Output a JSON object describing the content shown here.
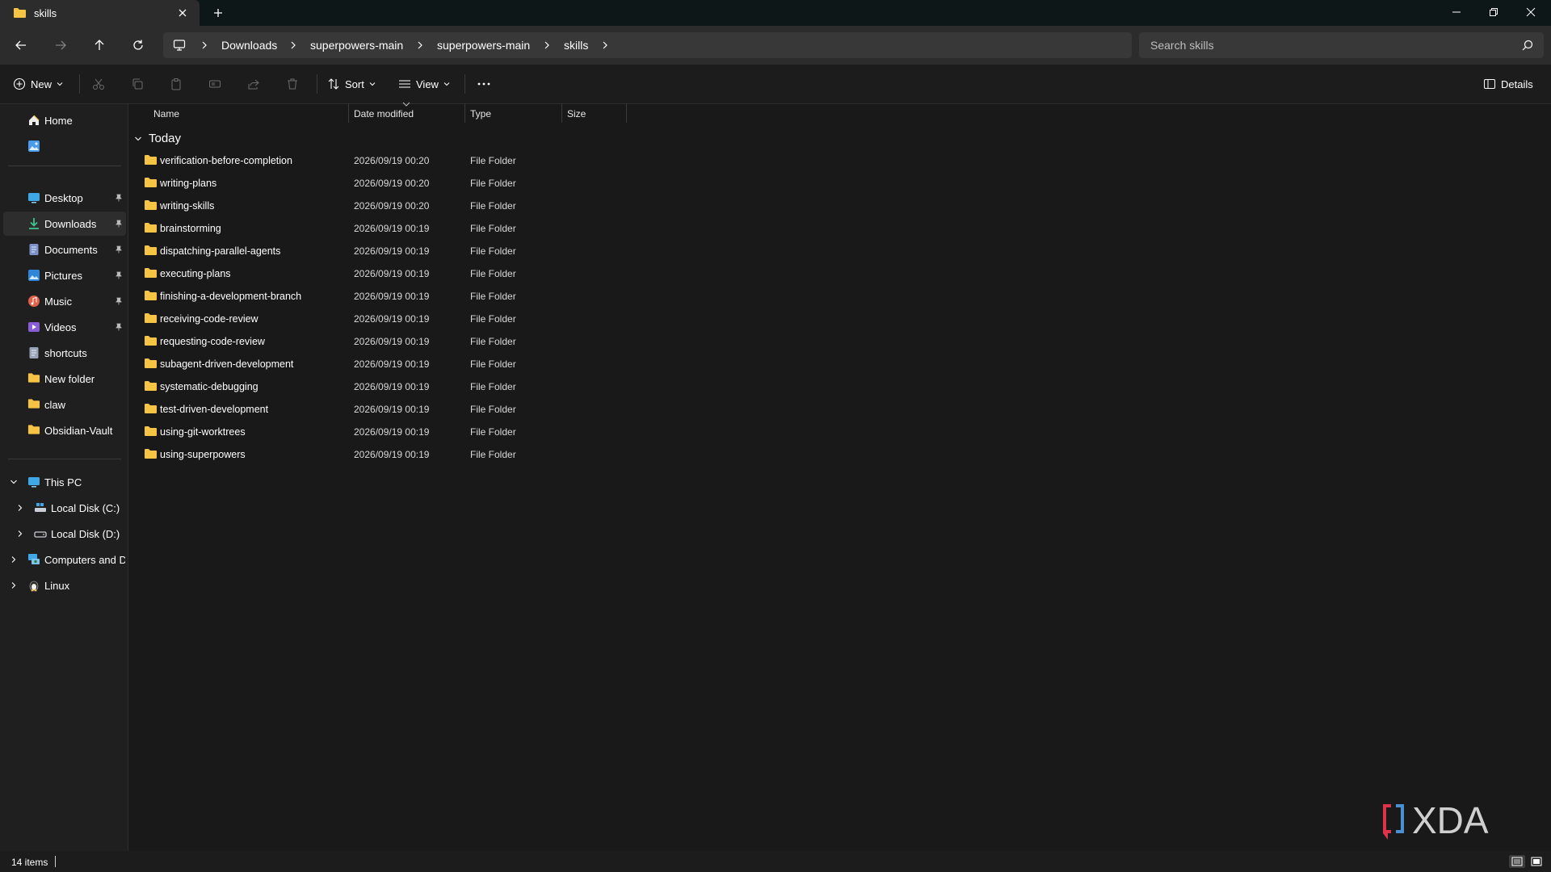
{
  "window": {
    "tab_title": "skills"
  },
  "breadcrumb": [
    "Downloads",
    "superpowers-main",
    "superpowers-main",
    "skills"
  ],
  "search": {
    "placeholder": "Search skills"
  },
  "toolbar": {
    "new_label": "New",
    "sort_label": "Sort",
    "view_label": "View",
    "details_label": "Details"
  },
  "sidebar": {
    "home": "Home",
    "quick_access": [
      "Desktop",
      "Downloads",
      "Documents",
      "Pictures",
      "Music",
      "Videos",
      "shortcuts",
      "New folder",
      "claw",
      "Obsidian-Vault"
    ],
    "this_pc": "This PC",
    "drives": [
      "Local Disk (C:)",
      "Local Disk (D:)"
    ],
    "network": "Computers and De",
    "linux": "Linux",
    "selected": "Downloads"
  },
  "columns": {
    "name": "Name",
    "date": "Date modified",
    "type": "Type",
    "size": "Size"
  },
  "group": {
    "label": "Today"
  },
  "files": [
    {
      "name": "verification-before-completion",
      "date": "2026/09/19 00:20",
      "type": "File Folder"
    },
    {
      "name": "writing-plans",
      "date": "2026/09/19 00:20",
      "type": "File Folder"
    },
    {
      "name": "writing-skills",
      "date": "2026/09/19 00:20",
      "type": "File Folder"
    },
    {
      "name": "brainstorming",
      "date": "2026/09/19 00:19",
      "type": "File Folder"
    },
    {
      "name": "dispatching-parallel-agents",
      "date": "2026/09/19 00:19",
      "type": "File Folder"
    },
    {
      "name": "executing-plans",
      "date": "2026/09/19 00:19",
      "type": "File Folder"
    },
    {
      "name": "finishing-a-development-branch",
      "date": "2026/09/19 00:19",
      "type": "File Folder"
    },
    {
      "name": "receiving-code-review",
      "date": "2026/09/19 00:19",
      "type": "File Folder"
    },
    {
      "name": "requesting-code-review",
      "date": "2026/09/19 00:19",
      "type": "File Folder"
    },
    {
      "name": "subagent-driven-development",
      "date": "2026/09/19 00:19",
      "type": "File Folder"
    },
    {
      "name": "systematic-debugging",
      "date": "2026/09/19 00:19",
      "type": "File Folder"
    },
    {
      "name": "test-driven-development",
      "date": "2026/09/19 00:19",
      "type": "File Folder"
    },
    {
      "name": "using-git-worktrees",
      "date": "2026/09/19 00:19",
      "type": "File Folder"
    },
    {
      "name": "using-superpowers",
      "date": "2026/09/19 00:19",
      "type": "File Folder"
    }
  ],
  "status": {
    "item_count": "14 items"
  },
  "watermark": {
    "text": "XDA"
  },
  "colors": {
    "folder": "#f6c445",
    "accent": "#4cc2ff",
    "logo_red": "#e0334a"
  }
}
